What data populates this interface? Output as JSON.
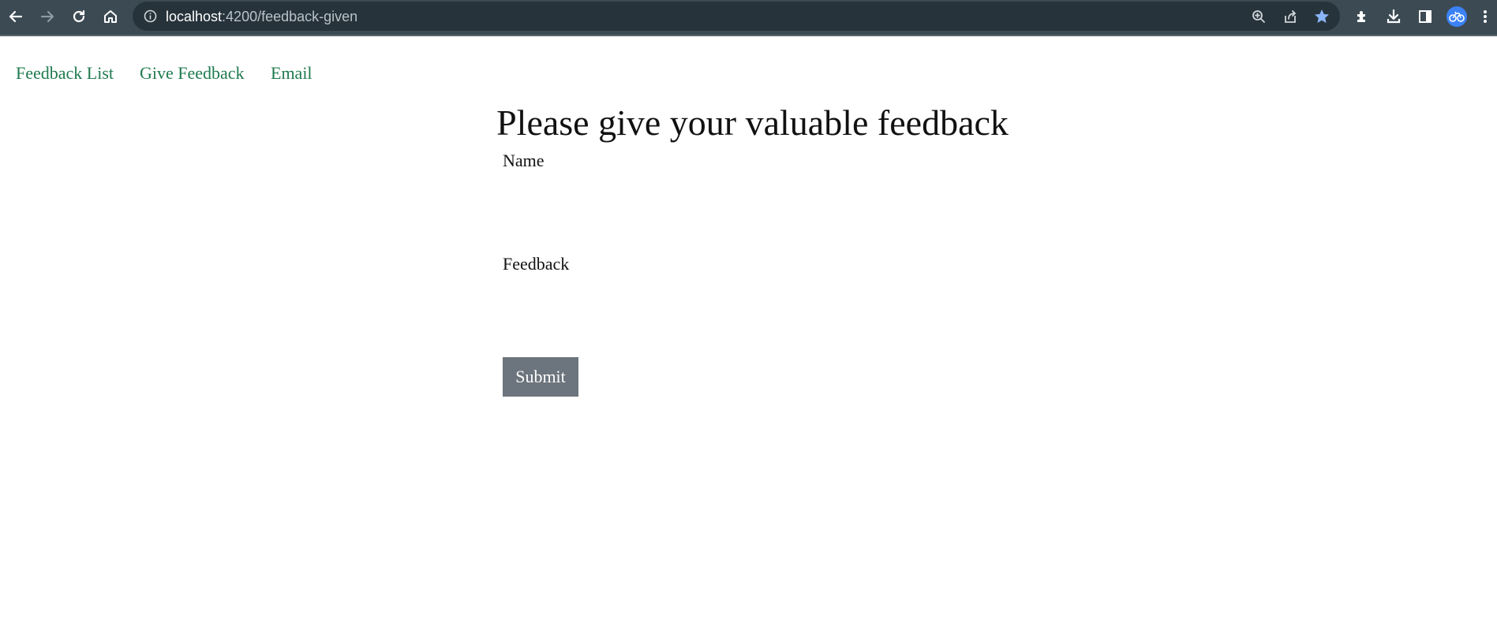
{
  "browser": {
    "url_host": "localhost",
    "url_path": ":4200/feedback-given",
    "icons": [
      "back-icon",
      "forward-icon",
      "reload-icon",
      "home-icon",
      "info-icon",
      "zoom-icon",
      "share-icon",
      "star-icon",
      "extensions-icon",
      "download-icon",
      "side-panel-icon",
      "profile-avatar",
      "menu-icon"
    ]
  },
  "nav": {
    "items": [
      {
        "label": "Feedback List"
      },
      {
        "label": "Give Feedback"
      },
      {
        "label": "Email"
      }
    ]
  },
  "form": {
    "title": "Please give your valuable feedback",
    "name_label": "Name",
    "name_value": "",
    "feedback_label": "Feedback",
    "feedback_value": "",
    "submit_label": "Submit"
  },
  "colors": {
    "chrome_bg": "#3c4a54",
    "omnibox_bg": "#27333b",
    "link": "#1f7a4e",
    "button_bg": "#6c757d",
    "star": "#8ab4f8"
  }
}
